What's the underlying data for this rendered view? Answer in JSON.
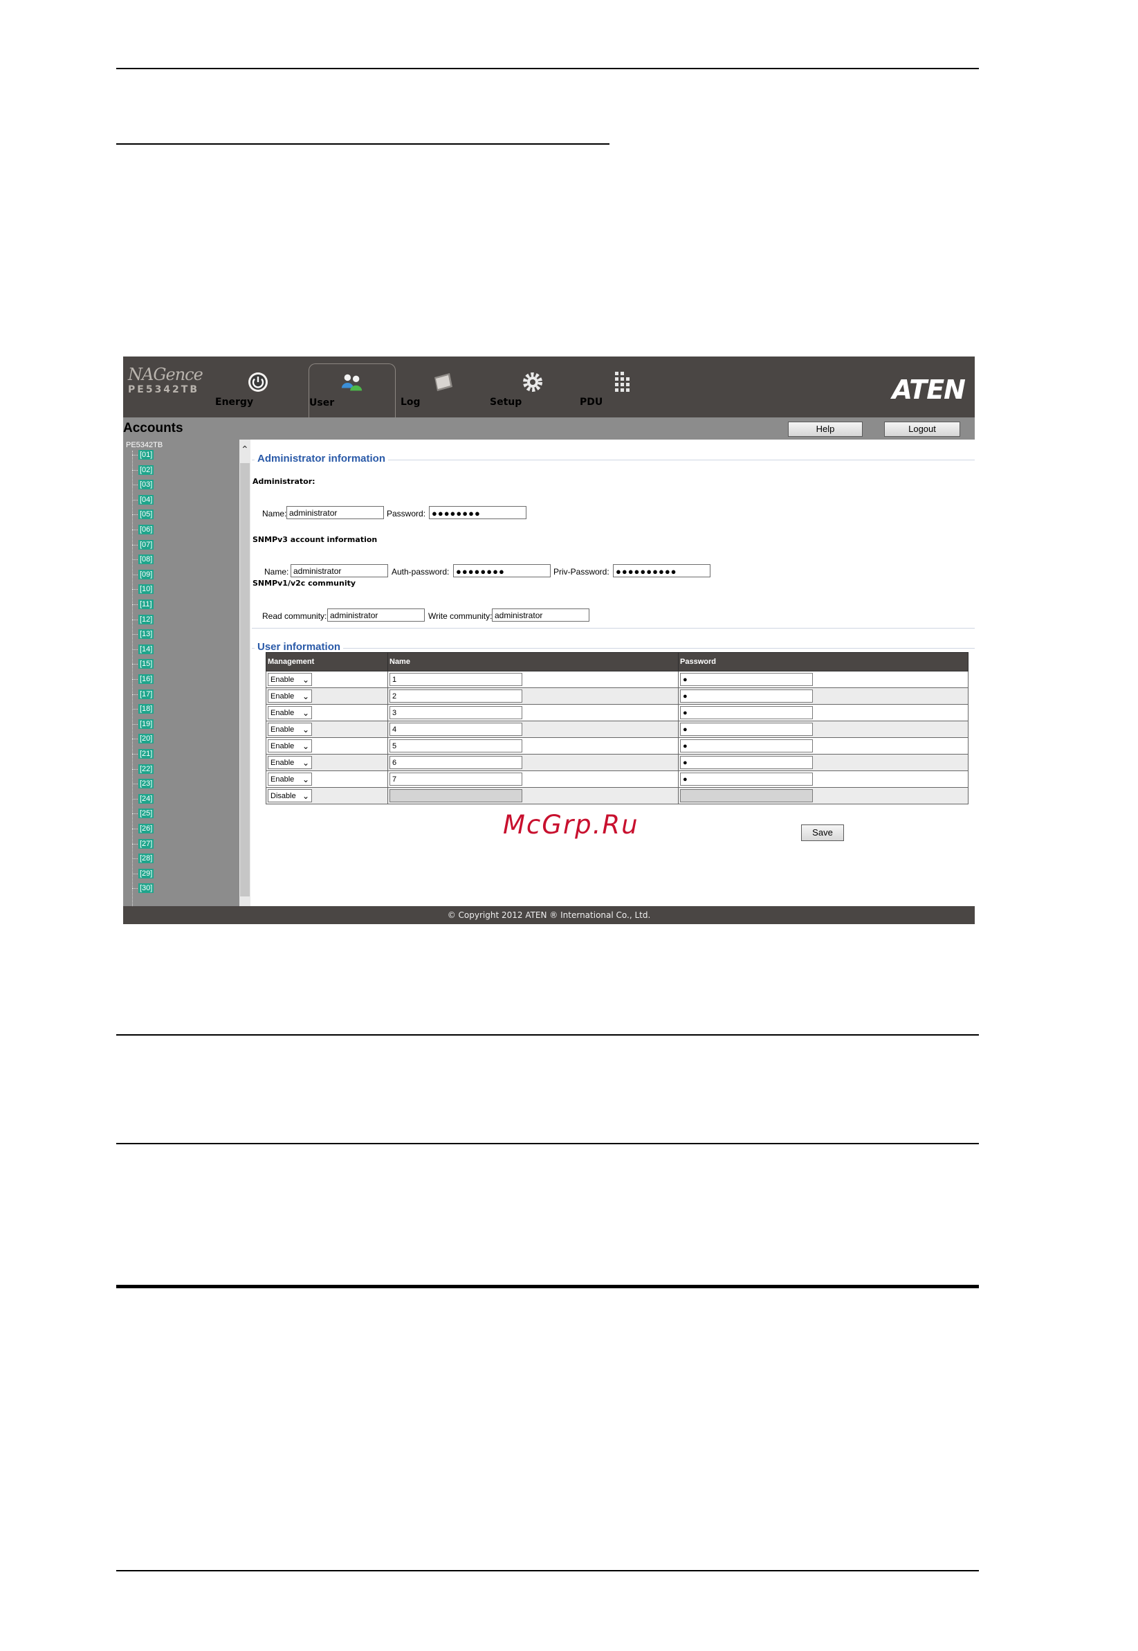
{
  "app": {
    "brand_logo": "NAGence",
    "brand_model": "PE5342TB",
    "tabs": [
      {
        "label": "Energy",
        "icon": "power-icon"
      },
      {
        "label": "User",
        "icon": "users-icon"
      },
      {
        "label": "Log",
        "icon": "log-icon"
      },
      {
        "label": "Setup",
        "icon": "gear-icon"
      },
      {
        "label": "PDU",
        "icon": "pdu-icon"
      }
    ],
    "active_tab": "User",
    "vendor_logo": "ATEN",
    "page_title": "Accounts",
    "help_label": "Help",
    "logout_label": "Logout"
  },
  "sidebar": {
    "root": "PE5342TB",
    "ports": [
      "[01]",
      "[02]",
      "[03]",
      "[04]",
      "[05]",
      "[06]",
      "[07]",
      "[08]",
      "[09]",
      "[10]",
      "[11]",
      "[12]",
      "[13]",
      "[14]",
      "[15]",
      "[16]",
      "[17]",
      "[18]",
      "[19]",
      "[20]",
      "[21]",
      "[22]",
      "[23]",
      "[24]",
      "[25]",
      "[26]",
      "[27]",
      "[28]",
      "[29]",
      "[30]"
    ]
  },
  "admin": {
    "section_title": "Administrator information",
    "admin_heading": "Administrator:",
    "name_label": "Name:",
    "name_value": "administrator",
    "password_label": "Password:",
    "password_value": "●●●●●●●●",
    "snmpv3_heading": "SNMPv3 account information",
    "snmpv3_name_label": "Name:",
    "snmpv3_name_value": "administrator",
    "auth_label": "Auth-password:",
    "auth_value": "●●●●●●●●",
    "priv_label": "Priv-Password:",
    "priv_value": "●●●●●●●●●●",
    "snmpv1_heading": "SNMPv1/v2c community",
    "read_label": "Read community:",
    "read_value": "administrator",
    "write_label": "Write community:",
    "write_value": "administrator"
  },
  "users": {
    "section_title": "User information",
    "columns": [
      "Management",
      "Name",
      "Password"
    ],
    "rows": [
      {
        "management": "Enable",
        "name": "1",
        "password": "●"
      },
      {
        "management": "Enable",
        "name": "2",
        "password": "●"
      },
      {
        "management": "Enable",
        "name": "3",
        "password": "●"
      },
      {
        "management": "Enable",
        "name": "4",
        "password": "●"
      },
      {
        "management": "Enable",
        "name": "5",
        "password": "●"
      },
      {
        "management": "Enable",
        "name": "6",
        "password": "●"
      },
      {
        "management": "Enable",
        "name": "7",
        "password": "●"
      },
      {
        "management": "Disable",
        "name": "",
        "password": ""
      }
    ],
    "save_label": "Save"
  },
  "footer": "© Copyright 2012 ATEN ® International Co., Ltd.",
  "watermark": "McGrp.Ru"
}
